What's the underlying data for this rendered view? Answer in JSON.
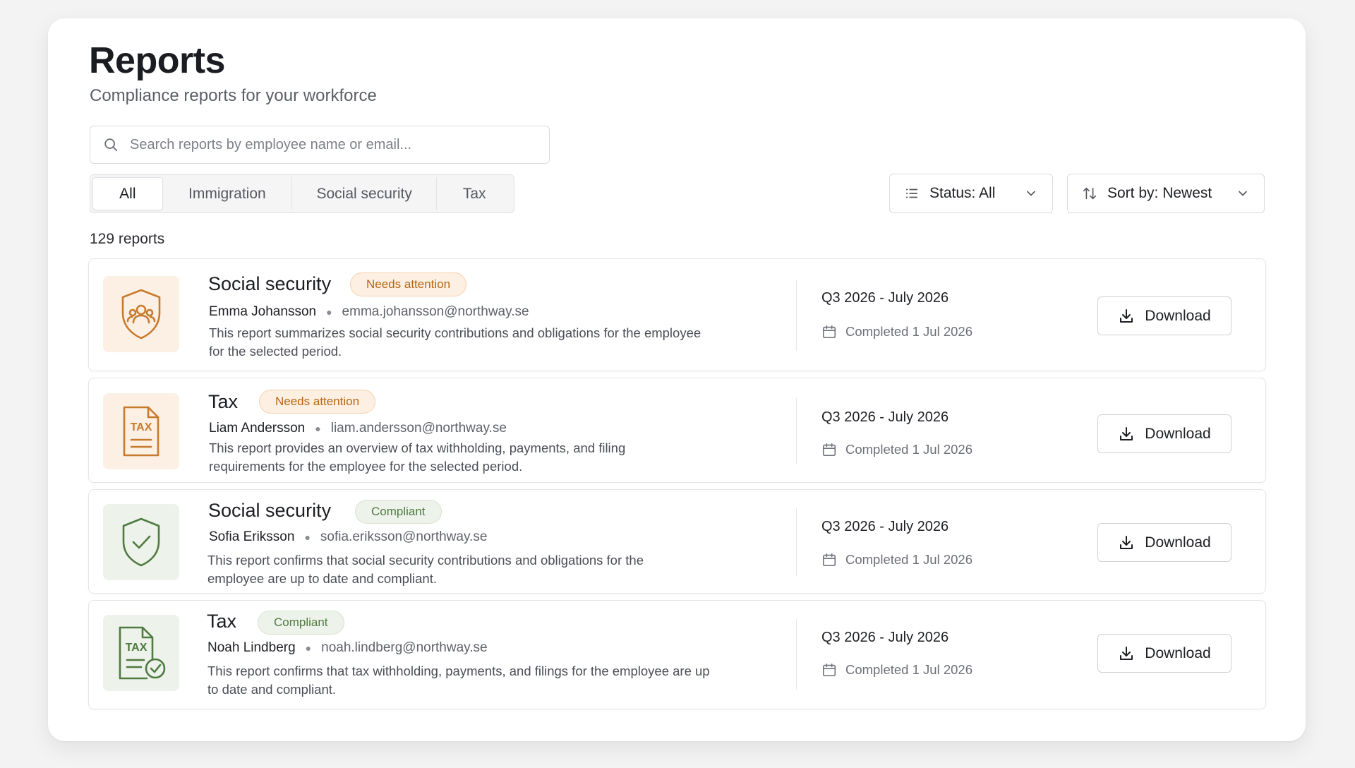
{
  "header": {
    "title": "Reports",
    "subtitle": "Compliance reports for your workforce"
  },
  "search": {
    "placeholder": "Search reports by employee name or email...",
    "value": ""
  },
  "tabs": [
    {
      "label": "All",
      "active": true
    },
    {
      "label": "Immigration",
      "active": false
    },
    {
      "label": "Social security",
      "active": false
    },
    {
      "label": "Tax",
      "active": false
    }
  ],
  "filters": {
    "status_label": "Status: All",
    "sort_label": "Sort by: Newest"
  },
  "report_count": "129 reports",
  "colors": {
    "warn_accent": "#c87a2c",
    "ok_accent": "#4f7a40"
  },
  "reports": [
    {
      "title": "Social security",
      "badge": "Needs attention",
      "status": "warn",
      "icon": "shield-people-icon",
      "name": "Emma Johansson",
      "email": "emma.johansson@northway.se",
      "description": "This report summarizes social security contributions and obligations for the employee for the selected period.",
      "period": "Q3 2026 - July 2026",
      "completed": "Completed 1 Jul 2026",
      "action": "Download"
    },
    {
      "title": "Tax",
      "badge": "Needs attention",
      "status": "warn",
      "icon": "tax-document-icon",
      "icon_text": "TAX",
      "name": "Liam Andersson",
      "email": "liam.andersson@northway.se",
      "description": "This report provides an overview of tax withholding, payments, and filing requirements for the employee for the selected period.",
      "period": "Q3 2026 - July 2026",
      "completed": "Completed 1 Jul 2026",
      "action": "Download"
    },
    {
      "title": "Social security",
      "badge": "Compliant",
      "status": "ok",
      "icon": "shield-check-icon",
      "name": "Sofia Eriksson",
      "email": "sofia.eriksson@northway.se",
      "description": "This report confirms that social security contributions and obligations for the employee are up to date and compliant.",
      "period": "Q3 2026 - July 2026",
      "completed": "Completed 1 Jul 2026",
      "action": "Download"
    },
    {
      "title": "Tax",
      "badge": "Compliant",
      "status": "ok",
      "icon": "tax-document-check-icon",
      "icon_text": "TAX",
      "name": "Noah Lindberg",
      "email": "noah.lindberg@northway.se",
      "description": "This report confirms that tax withholding, payments, and filings for the employee are up to date and compliant.",
      "period": "Q3 2026 - July 2026",
      "completed": "Completed 1 Jul 2026",
      "action": "Download"
    }
  ]
}
